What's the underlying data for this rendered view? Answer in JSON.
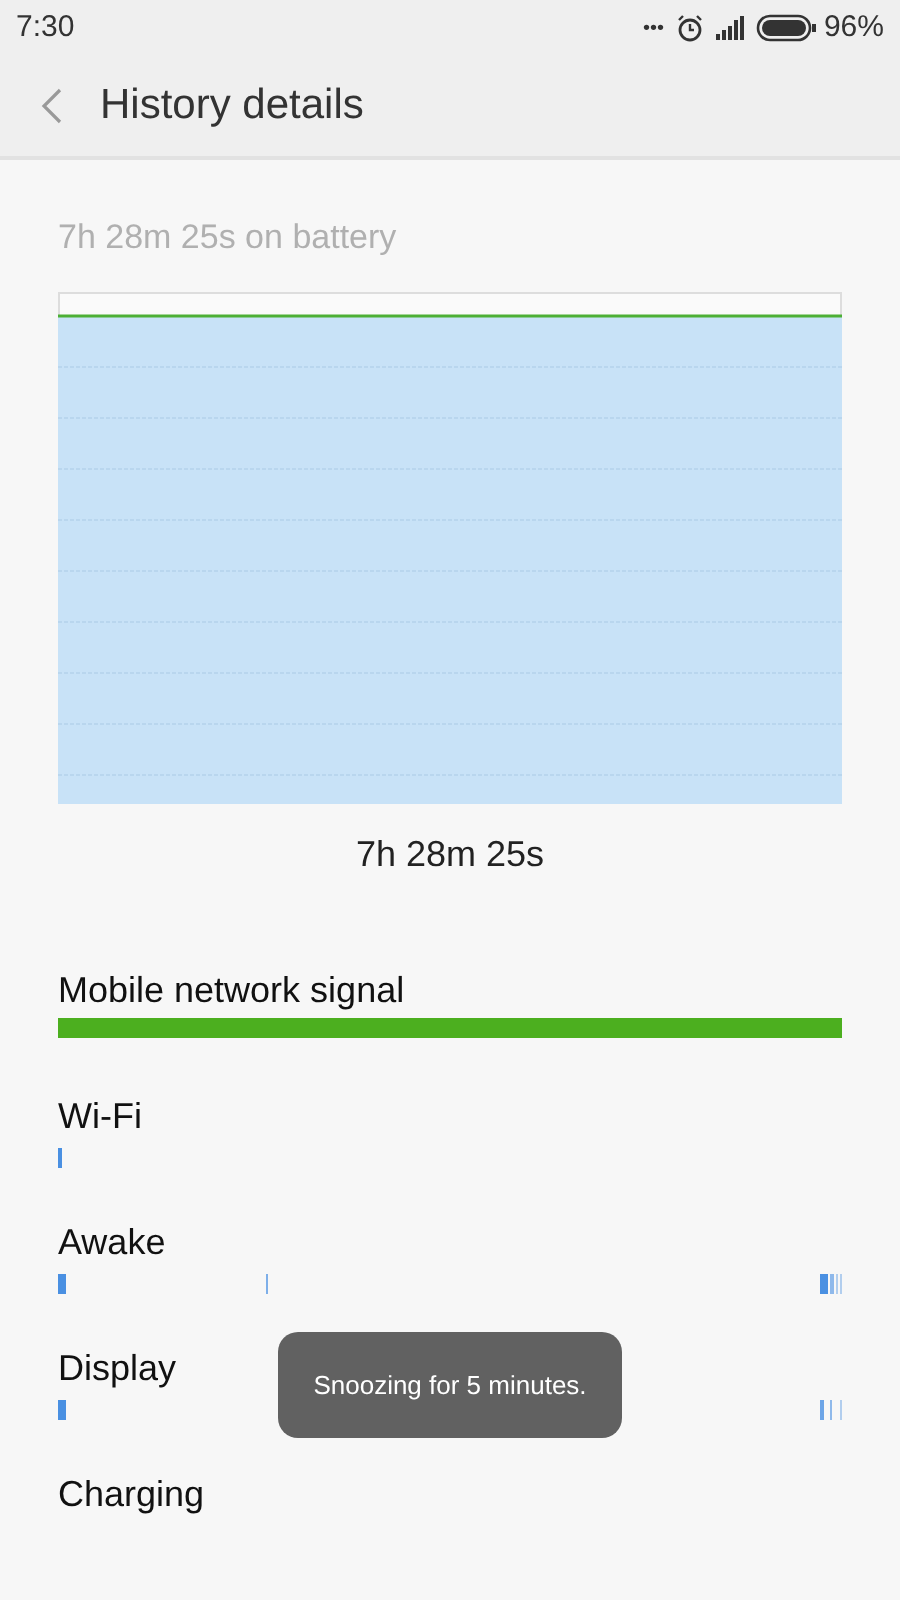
{
  "status_bar": {
    "time": "7:30",
    "overflow": "•••",
    "battery": "96%"
  },
  "header": {
    "title": "History details"
  },
  "summary": "7h 28m 25s on battery",
  "chart_duration": "7h 28m 25s",
  "tracks": [
    {
      "label": "Mobile network signal",
      "kind": "signal"
    },
    {
      "label": "Wi-Fi",
      "kind": "timeline"
    },
    {
      "label": "Awake",
      "kind": "timeline"
    },
    {
      "label": "Display",
      "kind": "timeline"
    },
    {
      "label": "Charging",
      "kind": "none"
    }
  ],
  "toast": "Snoozing for 5 minutes."
}
